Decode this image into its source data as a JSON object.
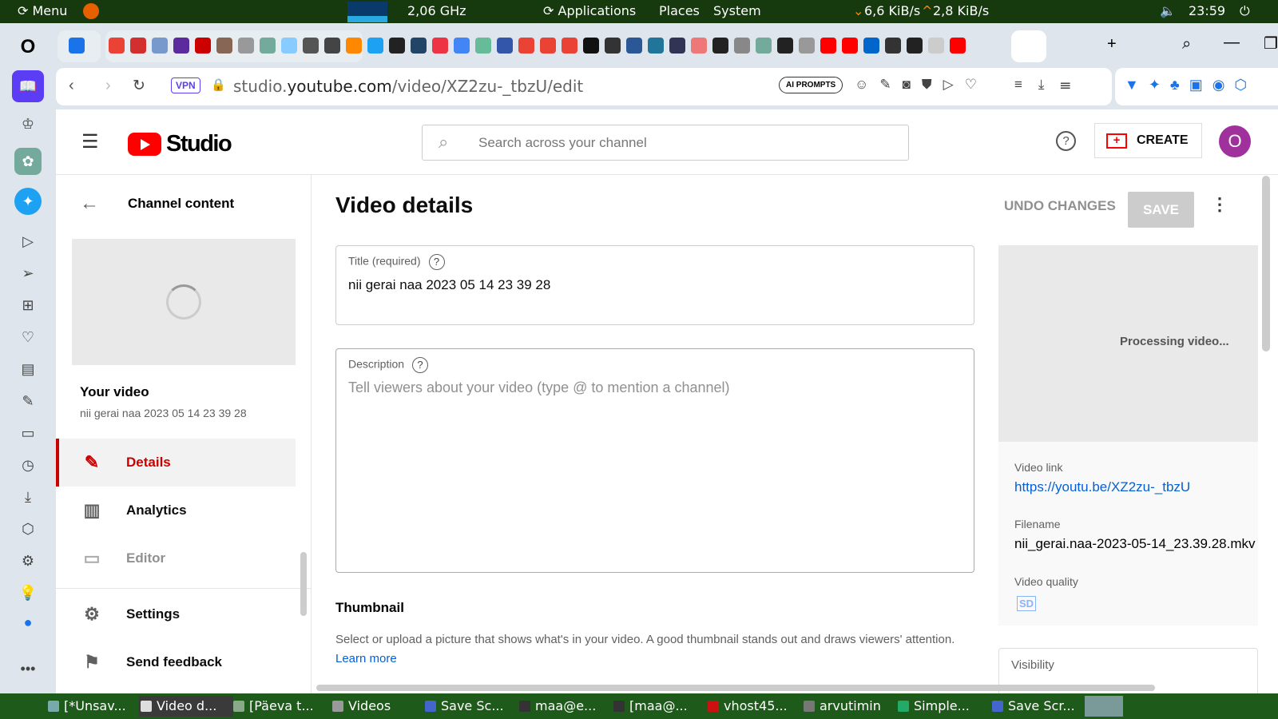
{
  "top_panel": {
    "menu": "Menu",
    "cpu": "2,06 GHz",
    "applications": "Applications",
    "places": "Places",
    "system": "System",
    "net_down": "6,6 KiB/s",
    "net_up": "2,8 KiB/s",
    "clock": "23:59"
  },
  "taskbar": {
    "tasks": [
      {
        "label": "[*Unsav...",
        "color": "#7aa"
      },
      {
        "label": "Video d...",
        "color": "#ddd"
      },
      {
        "label": "[Päeva t...",
        "color": "#8a8"
      },
      {
        "label": "Videos",
        "color": "#999"
      },
      {
        "label": "Save Sc...",
        "color": "#46c"
      },
      {
        "label": "maa@e...",
        "color": "#333"
      },
      {
        "label": "[maa@...",
        "color": "#333"
      },
      {
        "label": "vhost45...",
        "color": "#c11"
      },
      {
        "label": "arvutimin",
        "color": "#777"
      },
      {
        "label": "Simple...",
        "color": "#2a6"
      },
      {
        "label": "Save Scr...",
        "color": "#46c"
      }
    ]
  },
  "browser": {
    "favicons": [
      "#1a73e8",
      "#ea4335",
      "#d32f2f",
      "#79c",
      "#5b2a9c",
      "#c00",
      "#865",
      "#999",
      "#74aa9c",
      "#8cf",
      "#555",
      "#444",
      "#f80",
      "#1da1f2",
      "#222",
      "#246",
      "#e34",
      "#4285f4",
      "#6b9",
      "#35a",
      "#ea4335",
      "#ea4335",
      "#ea4335",
      "#111",
      "#333",
      "#2b5797",
      "#21759b",
      "#335",
      "#e77",
      "#222",
      "#888",
      "#74aa9c",
      "#222",
      "#999",
      "#f00",
      "#f00",
      "#06c",
      "#333",
      "#222",
      "#ccc",
      "#f00"
    ],
    "url_host": "studio.youtube.com",
    "url_path": "/video/XZ2zu-_tbzU/edit",
    "url_prefix": "studio.",
    "url_domain": "youtube.com",
    "vpn": "VPN",
    "ai_prompts": "AI PROMPTS"
  },
  "studio": {
    "logo": "Studio",
    "search_placeholder": "Search across your channel",
    "create": "CREATE",
    "avatar": "O",
    "nav": {
      "back_title": "Channel content",
      "your_video": "Your video",
      "video_title": "nii gerai naa 2023 05 14 23 39 28",
      "items": [
        {
          "label": "Details",
          "icon": "pencil-icon"
        },
        {
          "label": "Analytics",
          "icon": "analytics-icon"
        },
        {
          "label": "Editor",
          "icon": "editor-icon"
        },
        {
          "label": "Settings",
          "icon": "gear-icon"
        },
        {
          "label": "Send feedback",
          "icon": "feedback-icon"
        }
      ]
    },
    "main": {
      "heading": "Video details",
      "undo": "UNDO CHANGES",
      "save": "SAVE",
      "title_label": "Title (required)",
      "title_value": "nii gerai naa 2023 05 14 23 39 28",
      "desc_label": "Description",
      "desc_placeholder": "Tell viewers about your video (type @ to mention a channel)",
      "thumb_heading": "Thumbnail",
      "thumb_text": "Select or upload a picture that shows what's in your video. A good thumbnail stands out and draws viewers' attention.",
      "learn_more": "Learn more"
    },
    "side": {
      "processing": "Processing video...",
      "link_label": "Video link",
      "link": "https://youtu.be/XZ2zu-_tbzU",
      "filename_label": "Filename",
      "filename": "nii_gerai.naa-2023-05-14_23.39.28.mkv",
      "quality_label": "Video quality",
      "quality": "SD",
      "visibility_label": "Visibility"
    }
  },
  "colors": {
    "accent": "#cc0000",
    "link": "#065fd4",
    "panel": "#16390d",
    "opera": "#5b3df5"
  }
}
